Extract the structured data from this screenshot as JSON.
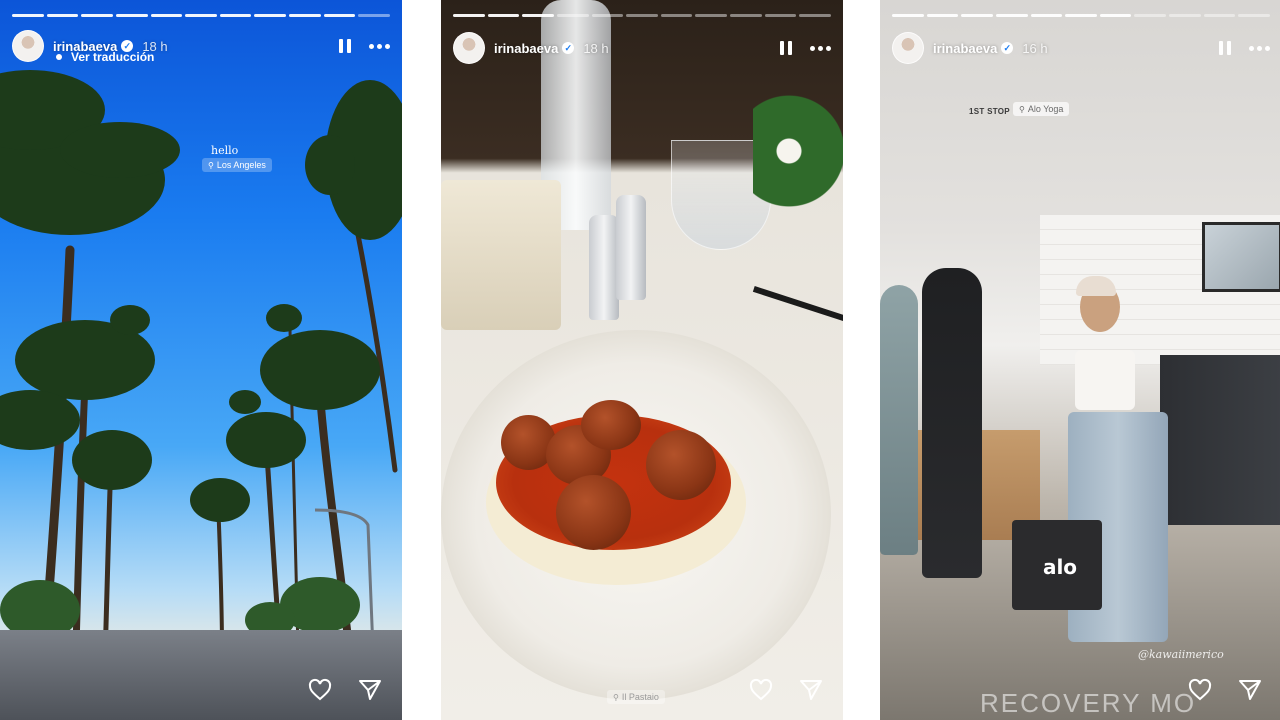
{
  "stories": [
    {
      "username": "irinabaeva",
      "time": "18 h",
      "translate_label": "Ver traducción",
      "sticker_text": "hello",
      "location": "Los Angeles",
      "progress": {
        "total_segments": 11,
        "completed_segments": 10
      }
    },
    {
      "username": "irinabaeva",
      "time": "18 h",
      "location": "Il Pastaio",
      "progress": {
        "total_segments": 11,
        "completed_segments": 3
      }
    },
    {
      "username": "irinabaeva",
      "time": "16 h",
      "stop_label": "1ST STOP",
      "location": "Alo Yoga",
      "bag_logo": "alo",
      "mention": "@kawaiimerico",
      "floor_text": "RECOVERY MO",
      "progress": {
        "total_segments": 11,
        "completed_segments": 7
      }
    }
  ],
  "icons": {
    "verified": "verified-badge-icon",
    "pause": "pause-icon",
    "more": "more-icon",
    "like": "heart-icon",
    "share": "send-icon",
    "location": "pin-icon"
  },
  "colors": {
    "verified_badge": "#1c7cf0",
    "overlay_text": "#ffffff"
  }
}
